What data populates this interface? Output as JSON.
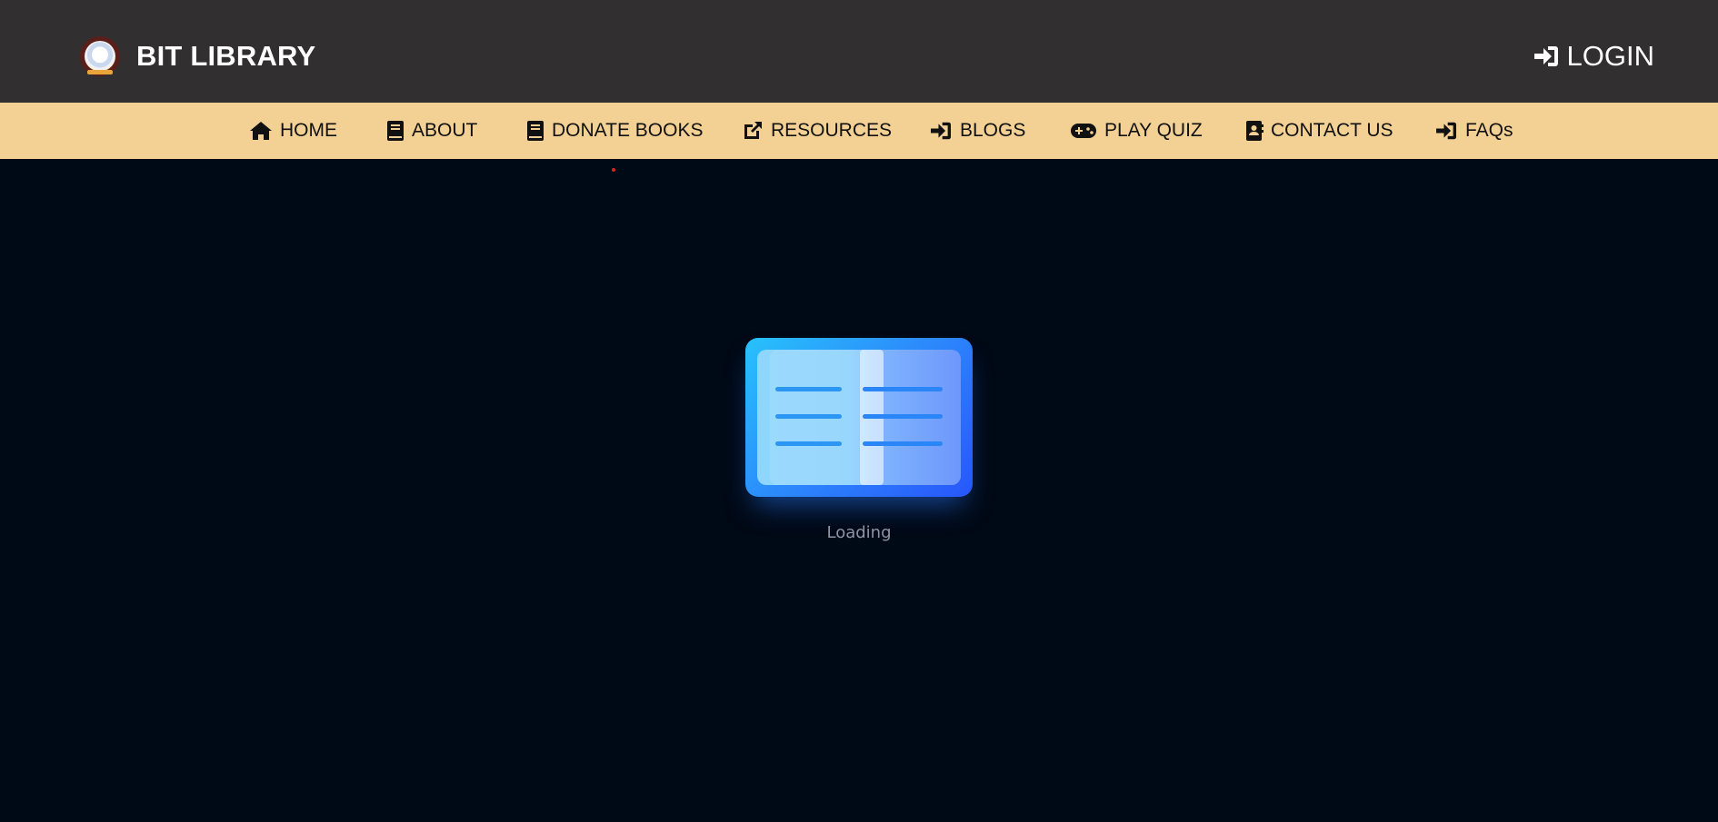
{
  "header": {
    "brand_title": "BIT LIBRARY",
    "logo_icon": "college-emblem-logo",
    "login_label": "LOGIN",
    "login_icon": "sign-in-icon"
  },
  "nav": {
    "items": [
      {
        "label": "HOME",
        "icon": "home-icon"
      },
      {
        "label": "ABOUT",
        "icon": "book-icon"
      },
      {
        "label": "DONATE BOOKS",
        "icon": "book-icon"
      },
      {
        "label": "RESOURCES",
        "icon": "external-link-icon"
      },
      {
        "label": "BLOGS",
        "icon": "sign-in-icon"
      },
      {
        "label": "PLAY QUIZ",
        "icon": "gamepad-icon"
      },
      {
        "label": "CONTACT US",
        "icon": "address-book-icon"
      },
      {
        "label": "FAQs",
        "icon": "sign-in-icon"
      }
    ]
  },
  "loader": {
    "text": "Loading",
    "icon": "open-book-icon"
  },
  "colors": {
    "topbar_bg": "#312f30",
    "navbar_bg": "#f3d195",
    "page_bg": "#000916",
    "loader_accent": "#2c8dfb"
  }
}
